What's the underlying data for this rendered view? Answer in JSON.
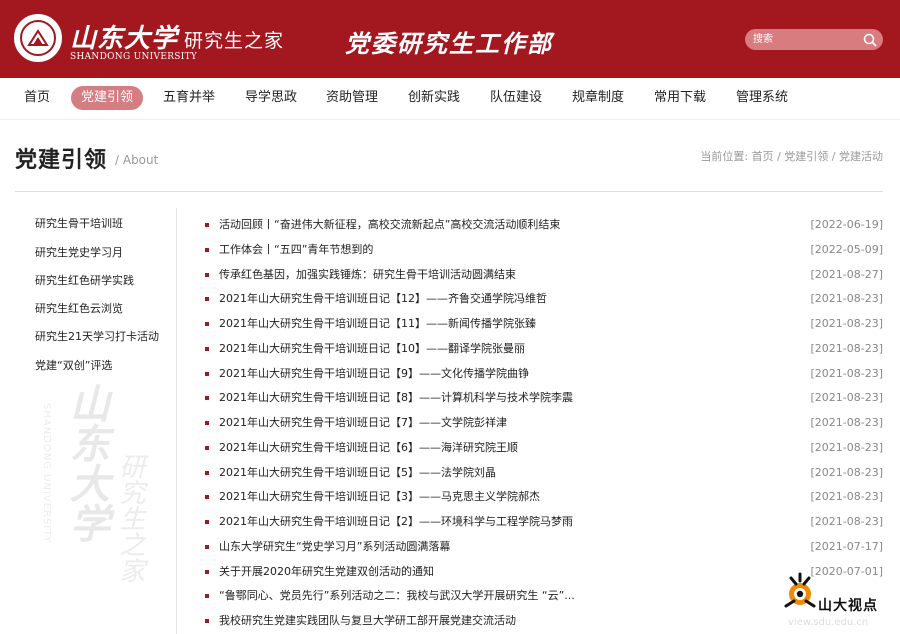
{
  "header": {
    "brand_calligraphy": "山东大学",
    "brand_subtitle": "研究生之家",
    "brand_english": "SHANDONG UNIVERSITY",
    "department": "党委研究生工作部",
    "search_placeholder": "搜索"
  },
  "nav": {
    "items": [
      {
        "label": "首页"
      },
      {
        "label": "党建引领"
      },
      {
        "label": "五育并举"
      },
      {
        "label": "导学思政"
      },
      {
        "label": "资助管理"
      },
      {
        "label": "创新实践"
      },
      {
        "label": "队伍建设"
      },
      {
        "label": "规章制度"
      },
      {
        "label": "常用下载"
      },
      {
        "label": "管理系统"
      }
    ],
    "active_index": 1
  },
  "page": {
    "title": "党建引领",
    "title_en": "/ About",
    "breadcrumb_prefix": "当前位置:",
    "breadcrumb": [
      "首页",
      "党建引领",
      "党建活动"
    ]
  },
  "sidebar": {
    "items": [
      {
        "label": "研究生骨干培训班"
      },
      {
        "label": "研究生党史学习月"
      },
      {
        "label": "研究生红色研学实践"
      },
      {
        "label": "研究生红色云浏览"
      },
      {
        "label": "研究生21天学习打卡活动"
      },
      {
        "label": "党建“双创”评选"
      }
    ]
  },
  "news": [
    {
      "title": "活动回顾丨“奋进伟大新征程，高校交流新起点”高校交流活动顺利结束",
      "date": "[2022-06-19]"
    },
    {
      "title": "工作体会丨“五四”青年节想到的",
      "date": "[2022-05-09]"
    },
    {
      "title": "传承红色基因，加强实践锤炼：研究生骨干培训活动圆满结束",
      "date": "[2021-08-27]"
    },
    {
      "title": "2021年山大研究生骨干培训班日记【12】——齐鲁交通学院冯维哲",
      "date": "[2021-08-23]"
    },
    {
      "title": "2021年山大研究生骨干培训班日记【11】——新闻传播学院张臻",
      "date": "[2021-08-23]"
    },
    {
      "title": "2021年山大研究生骨干培训班日记【10】——翻译学院张曼丽",
      "date": "[2021-08-23]"
    },
    {
      "title": "2021年山大研究生骨干培训班日记【9】——文化传播学院曲铮",
      "date": "[2021-08-23]"
    },
    {
      "title": "2021年山大研究生骨干培训班日记【8】——计算机科学与技术学院李震",
      "date": "[2021-08-23]"
    },
    {
      "title": "2021年山大研究生骨干培训班日记【7】——文学院彭祥津",
      "date": "[2021-08-23]"
    },
    {
      "title": "2021年山大研究生骨干培训班日记【6】——海洋研究院王顺",
      "date": "[2021-08-23]"
    },
    {
      "title": "2021年山大研究生骨干培训班日记【5】——法学院刘晶",
      "date": "[2021-08-23]"
    },
    {
      "title": "2021年山大研究生骨干培训班日记【3】——马克思主义学院郝杰",
      "date": "[2021-08-23]"
    },
    {
      "title": "2021年山大研究生骨干培训班日记【2】——环境科学与工程学院马梦雨",
      "date": "[2021-08-23]"
    },
    {
      "title": "山东大学研究生“党史学习月”系列活动圆满落幕",
      "date": "[2021-07-17]"
    },
    {
      "title": "关于开展2020年研究生党建双创活动的通知",
      "date": "[2020-07-01]"
    },
    {
      "title": "“鲁鄂同心、党员先行”系列活动之二：我校与武汉大学开展研究生 “云”...",
      "date": ""
    },
    {
      "title": "我校研究生党建实践团队与复旦大学研工部开展党建交流活动",
      "date": ""
    }
  ],
  "corner_logo": {
    "text": "山大视点",
    "url": "view.sdu.edu.cn"
  },
  "colors": {
    "brand_red": "#a3171f",
    "nav_active": "#d47e83",
    "search_bg": "#d97c7f"
  }
}
